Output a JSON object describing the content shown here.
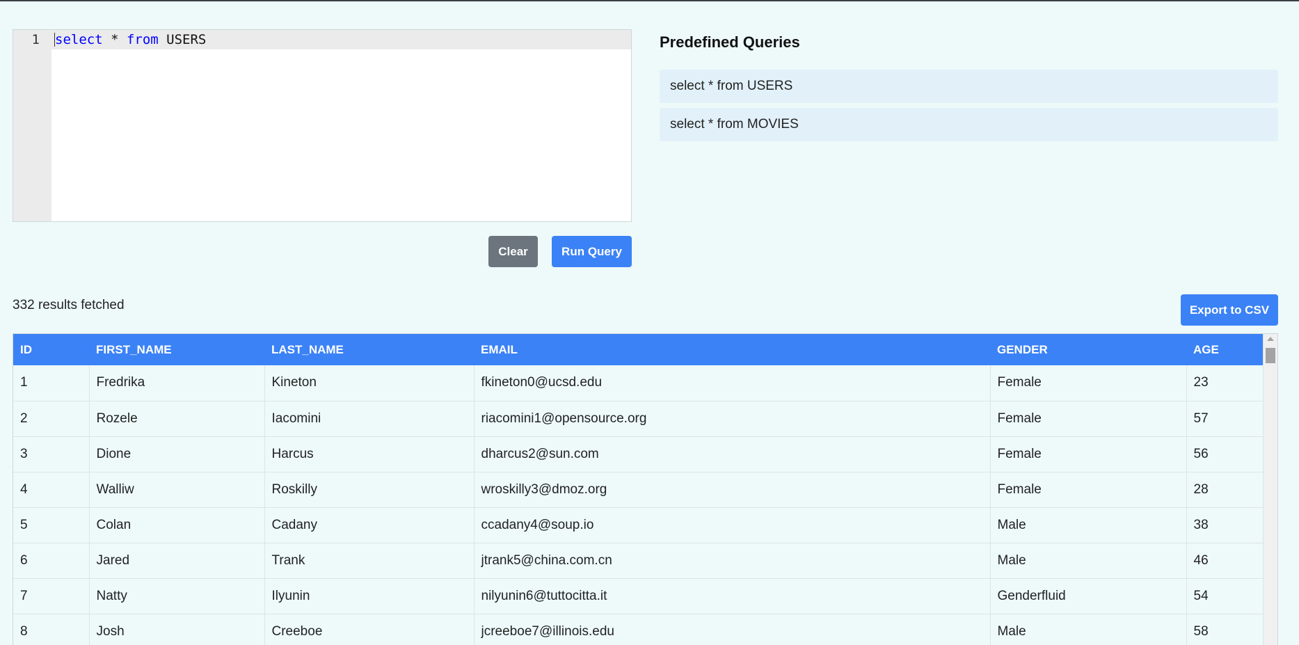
{
  "editor": {
    "line_number": "1",
    "code_keyword1": "select",
    "code_mid": " * ",
    "code_keyword2": "from",
    "code_rest": " USERS"
  },
  "buttons": {
    "clear": "Clear",
    "run": "Run Query",
    "export": "Export to CSV"
  },
  "predefined": {
    "title": "Predefined Queries",
    "items": [
      "select * from USERS",
      "select * from MOVIES"
    ]
  },
  "results": {
    "count_text": "332 results fetched"
  },
  "table": {
    "columns": [
      "ID",
      "FIRST_NAME",
      "LAST_NAME",
      "EMAIL",
      "GENDER",
      "AGE"
    ],
    "rows": [
      [
        "1",
        "Fredrika",
        "Kineton",
        "fkineton0@ucsd.edu",
        "Female",
        "23"
      ],
      [
        "2",
        "Rozele",
        "Iacomini",
        "riacomini1@opensource.org",
        "Female",
        "57"
      ],
      [
        "3",
        "Dione",
        "Harcus",
        "dharcus2@sun.com",
        "Female",
        "56"
      ],
      [
        "4",
        "Walliw",
        "Roskilly",
        "wroskilly3@dmoz.org",
        "Female",
        "28"
      ],
      [
        "5",
        "Colan",
        "Cadany",
        "ccadany4@soup.io",
        "Male",
        "38"
      ],
      [
        "6",
        "Jared",
        "Trank",
        "jtrank5@china.com.cn",
        "Male",
        "46"
      ],
      [
        "7",
        "Natty",
        "Ilyunin",
        "nilyunin6@tuttocitta.it",
        "Genderfluid",
        "54"
      ],
      [
        "8",
        "Josh",
        "Creeboe",
        "jcreeboe7@illinois.edu",
        "Male",
        "58"
      ]
    ]
  },
  "colors": {
    "accent": "#3b82f6",
    "secondary": "#6c757d",
    "background": "#eefafa"
  }
}
